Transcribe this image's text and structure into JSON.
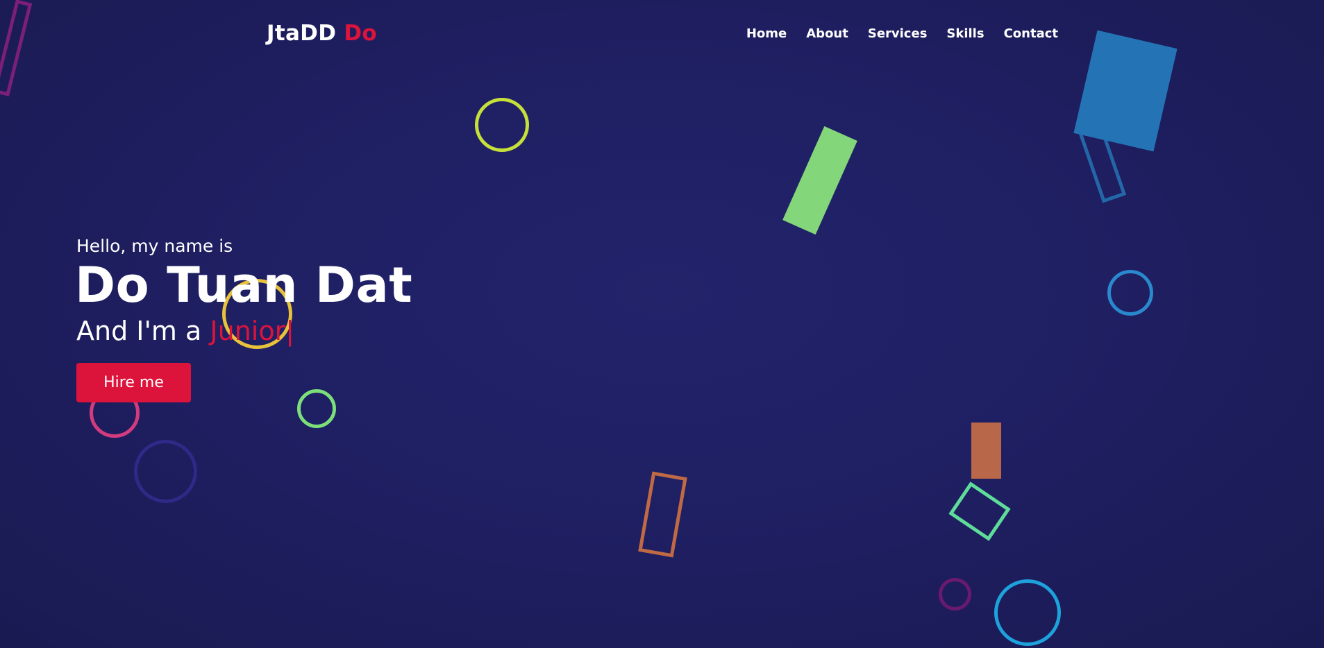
{
  "navbar": {
    "logo_primary": "JtaDD",
    "logo_accent": "Do",
    "menu": [
      {
        "label": "Home"
      },
      {
        "label": "About"
      },
      {
        "label": "Services"
      },
      {
        "label": "Skills"
      },
      {
        "label": "Contact"
      }
    ]
  },
  "hero": {
    "intro": "Hello, my name is",
    "name": "Do Tuan Dat",
    "role_prefix": "And I'm a ",
    "role_typed": "Junior",
    "cursor": "|",
    "cta_label": "Hire me"
  },
  "theme": {
    "background": "#1f1f63",
    "accent": "#dc143c",
    "text": "#ffffff"
  },
  "decor_shapes": [
    {
      "kind": "rect-outline",
      "color": "#7b1f7a"
    },
    {
      "kind": "circle-outline",
      "color": "#c6e03a"
    },
    {
      "kind": "rect-filled",
      "color": "#84d67a"
    },
    {
      "kind": "rect-filled",
      "color": "#2474b5"
    },
    {
      "kind": "rect-outline",
      "color": "#2474b5"
    },
    {
      "kind": "circle-outline",
      "color": "#2a88cc"
    },
    {
      "kind": "circle-outline",
      "color": "#e8c23a"
    },
    {
      "kind": "circle-outline",
      "color": "#7ce07a"
    },
    {
      "kind": "circle-outline",
      "color": "#d43b7f"
    },
    {
      "kind": "circle-outline",
      "color": "#2d2a88"
    },
    {
      "kind": "rect-outline",
      "color": "#c06a45"
    },
    {
      "kind": "rect-filled",
      "color": "#b86849"
    },
    {
      "kind": "rect-outline",
      "color": "#5fdc9a"
    },
    {
      "kind": "circle-outline",
      "color": "#6a1a6e"
    },
    {
      "kind": "circle-outline",
      "color": "#1ea2dc"
    }
  ]
}
